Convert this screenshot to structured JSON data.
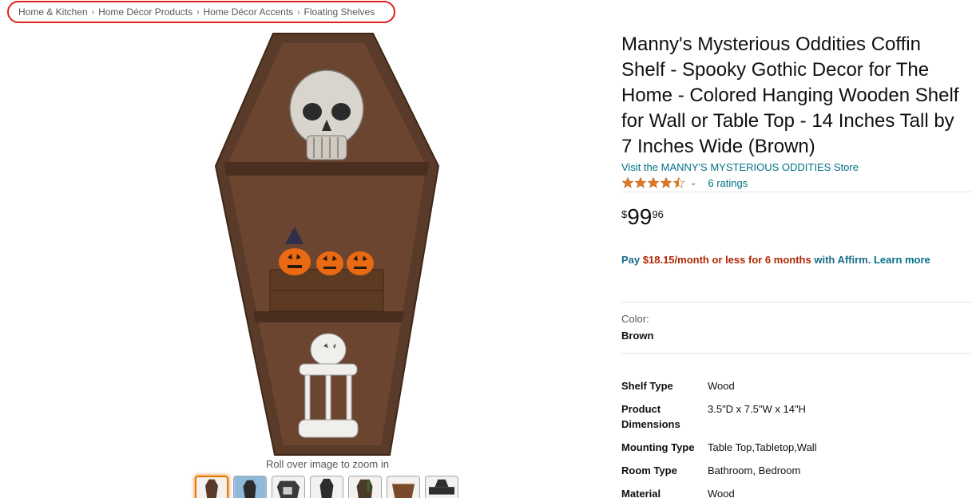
{
  "breadcrumb": {
    "items": [
      "Home & Kitchen",
      "Home Décor Products",
      "Home Décor Accents",
      "Floating Shelves"
    ],
    "separator": "›",
    "highlight_color": "#e02020"
  },
  "gallery": {
    "zoom_hint": "Roll over image to zoom in",
    "thumbnail_count": 7,
    "active_thumbnail": 1
  },
  "product": {
    "title": "Manny's Mysterious Oddities Coffin Shelf - Spooky Gothic Decor for The Home - Colored Hanging Wooden Shelf for Wall or Table Top - 14 Inches Tall by 7 Inches Wide (Brown)",
    "store_link": "Visit the MANNY'S MYSTERIOUS ODDITIES Store",
    "rating_stars": 4.5,
    "ratings_count": "6 ratings",
    "price": {
      "symbol": "$",
      "whole": "99",
      "fraction": "96"
    },
    "affirm": {
      "prefix": "Pay",
      "amount": "$18.15/month or less for 6 months",
      "suffix": "with Affirm.",
      "learn_more": "Learn more"
    },
    "color_label": "Color:",
    "color_value": "Brown",
    "specs": [
      {
        "key": "Shelf Type",
        "value": "Wood"
      },
      {
        "key": "Product Dimensions",
        "value": "3.5\"D x 7.5\"W x 14\"H"
      },
      {
        "key": "Mounting Type",
        "value": "Table Top,Tabletop,Wall"
      },
      {
        "key": "Room Type",
        "value": "Bathroom, Bedroom"
      },
      {
        "key": "Material",
        "value": "Wood"
      }
    ]
  },
  "colors": {
    "link": "#007185",
    "star": "#de7921",
    "price_red": "#b12704",
    "coffin_wood": "#5a3a28"
  }
}
